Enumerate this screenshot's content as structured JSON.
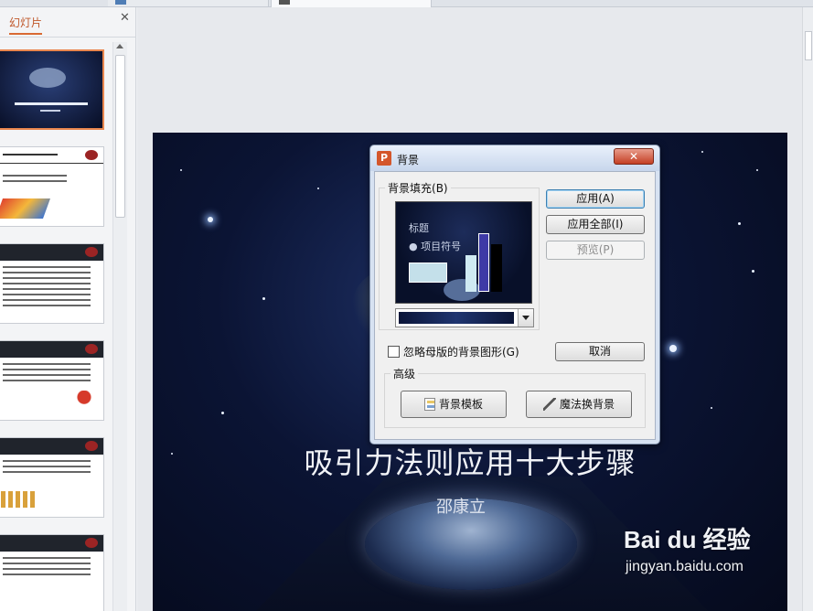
{
  "panel": {
    "tab_label": "幻灯片",
    "close_glyph": "✕"
  },
  "slide": {
    "title": "吸引力法则应用十大步骤",
    "subtitle": "邵康立"
  },
  "dialog": {
    "title": "背景",
    "close_glyph": "✕",
    "fill_group_label": "背景填充",
    "fill_group_hotkey": "(B)",
    "preview_text_1": "标题",
    "preview_text_2": "● 项目符号",
    "apply": "应用(A)",
    "apply_all": "应用全部(I)",
    "preview": "预览(P)",
    "cancel": "取消",
    "ignore_master": "忽略母版的背景图形(G)",
    "ignore_master_checked": false,
    "advanced_label": "高级",
    "template_button": "背景模板",
    "magic_button": "魔法换背景"
  },
  "watermark": {
    "brand": "Bai du 经验",
    "url": "jingyan.baidu.com"
  },
  "colors": {
    "accent": "#d96a33",
    "slide_bg": "#0b1434",
    "dialog_close": "#c43f24"
  }
}
